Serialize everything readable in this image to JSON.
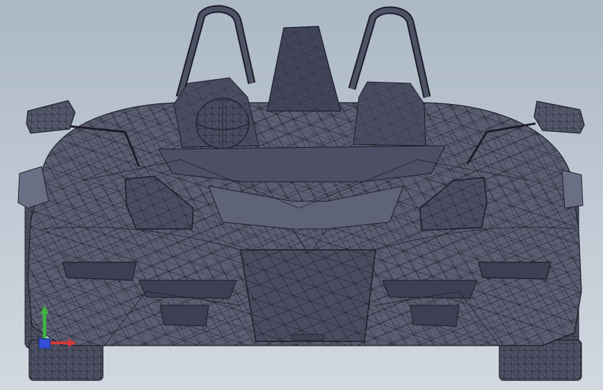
{
  "viewport": {
    "background_top": "#acb8c6",
    "background_bottom": "#d2d8e0"
  },
  "model": {
    "body_fill": "#5b5f72",
    "body_fill_light": "#6a6f84",
    "body_fill_dark": "#3f4254",
    "mesh_stroke": "#1b1c26",
    "mesh_light": "#8a90a6",
    "helmet_icon": "wireframe-sphere"
  },
  "triad": {
    "y_color": "#3fb43f",
    "x_color": "#d23a3a",
    "z_color": "#3550d6",
    "icon": "axis-triad-icon"
  }
}
